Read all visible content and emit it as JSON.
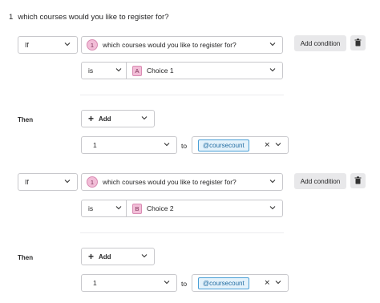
{
  "question": {
    "number": "1",
    "text": "which courses would you like to register for?"
  },
  "blocks": [
    {
      "if_label": "If",
      "question_num": "1",
      "question_text": "which courses would you like to register for?",
      "operator": "is",
      "choice_letter": "A",
      "choice_text": "Choice 1",
      "add_condition": "Add condition",
      "then_label": "Then",
      "add_label": "Add",
      "value": "1",
      "to_label": "to",
      "variable": "@coursecount"
    },
    {
      "if_label": "If",
      "question_num": "1",
      "question_text": "which courses would you like to register for?",
      "operator": "is",
      "choice_letter": "B",
      "choice_text": "Choice 2",
      "add_condition": "Add condition",
      "then_label": "Then",
      "add_label": "Add",
      "value": "1",
      "to_label": "to",
      "variable": "@coursecount"
    }
  ],
  "icons": {
    "chevron": "chevron-down-icon",
    "trash": "trash-icon",
    "clear": "clear-x-icon",
    "plus": "plus-icon"
  },
  "colors": {
    "pill": "#f2bdd7",
    "chip_border": "#4a9fd6",
    "chip_bg": "#e4f2fb",
    "gray_button": "#e8e8ea"
  }
}
